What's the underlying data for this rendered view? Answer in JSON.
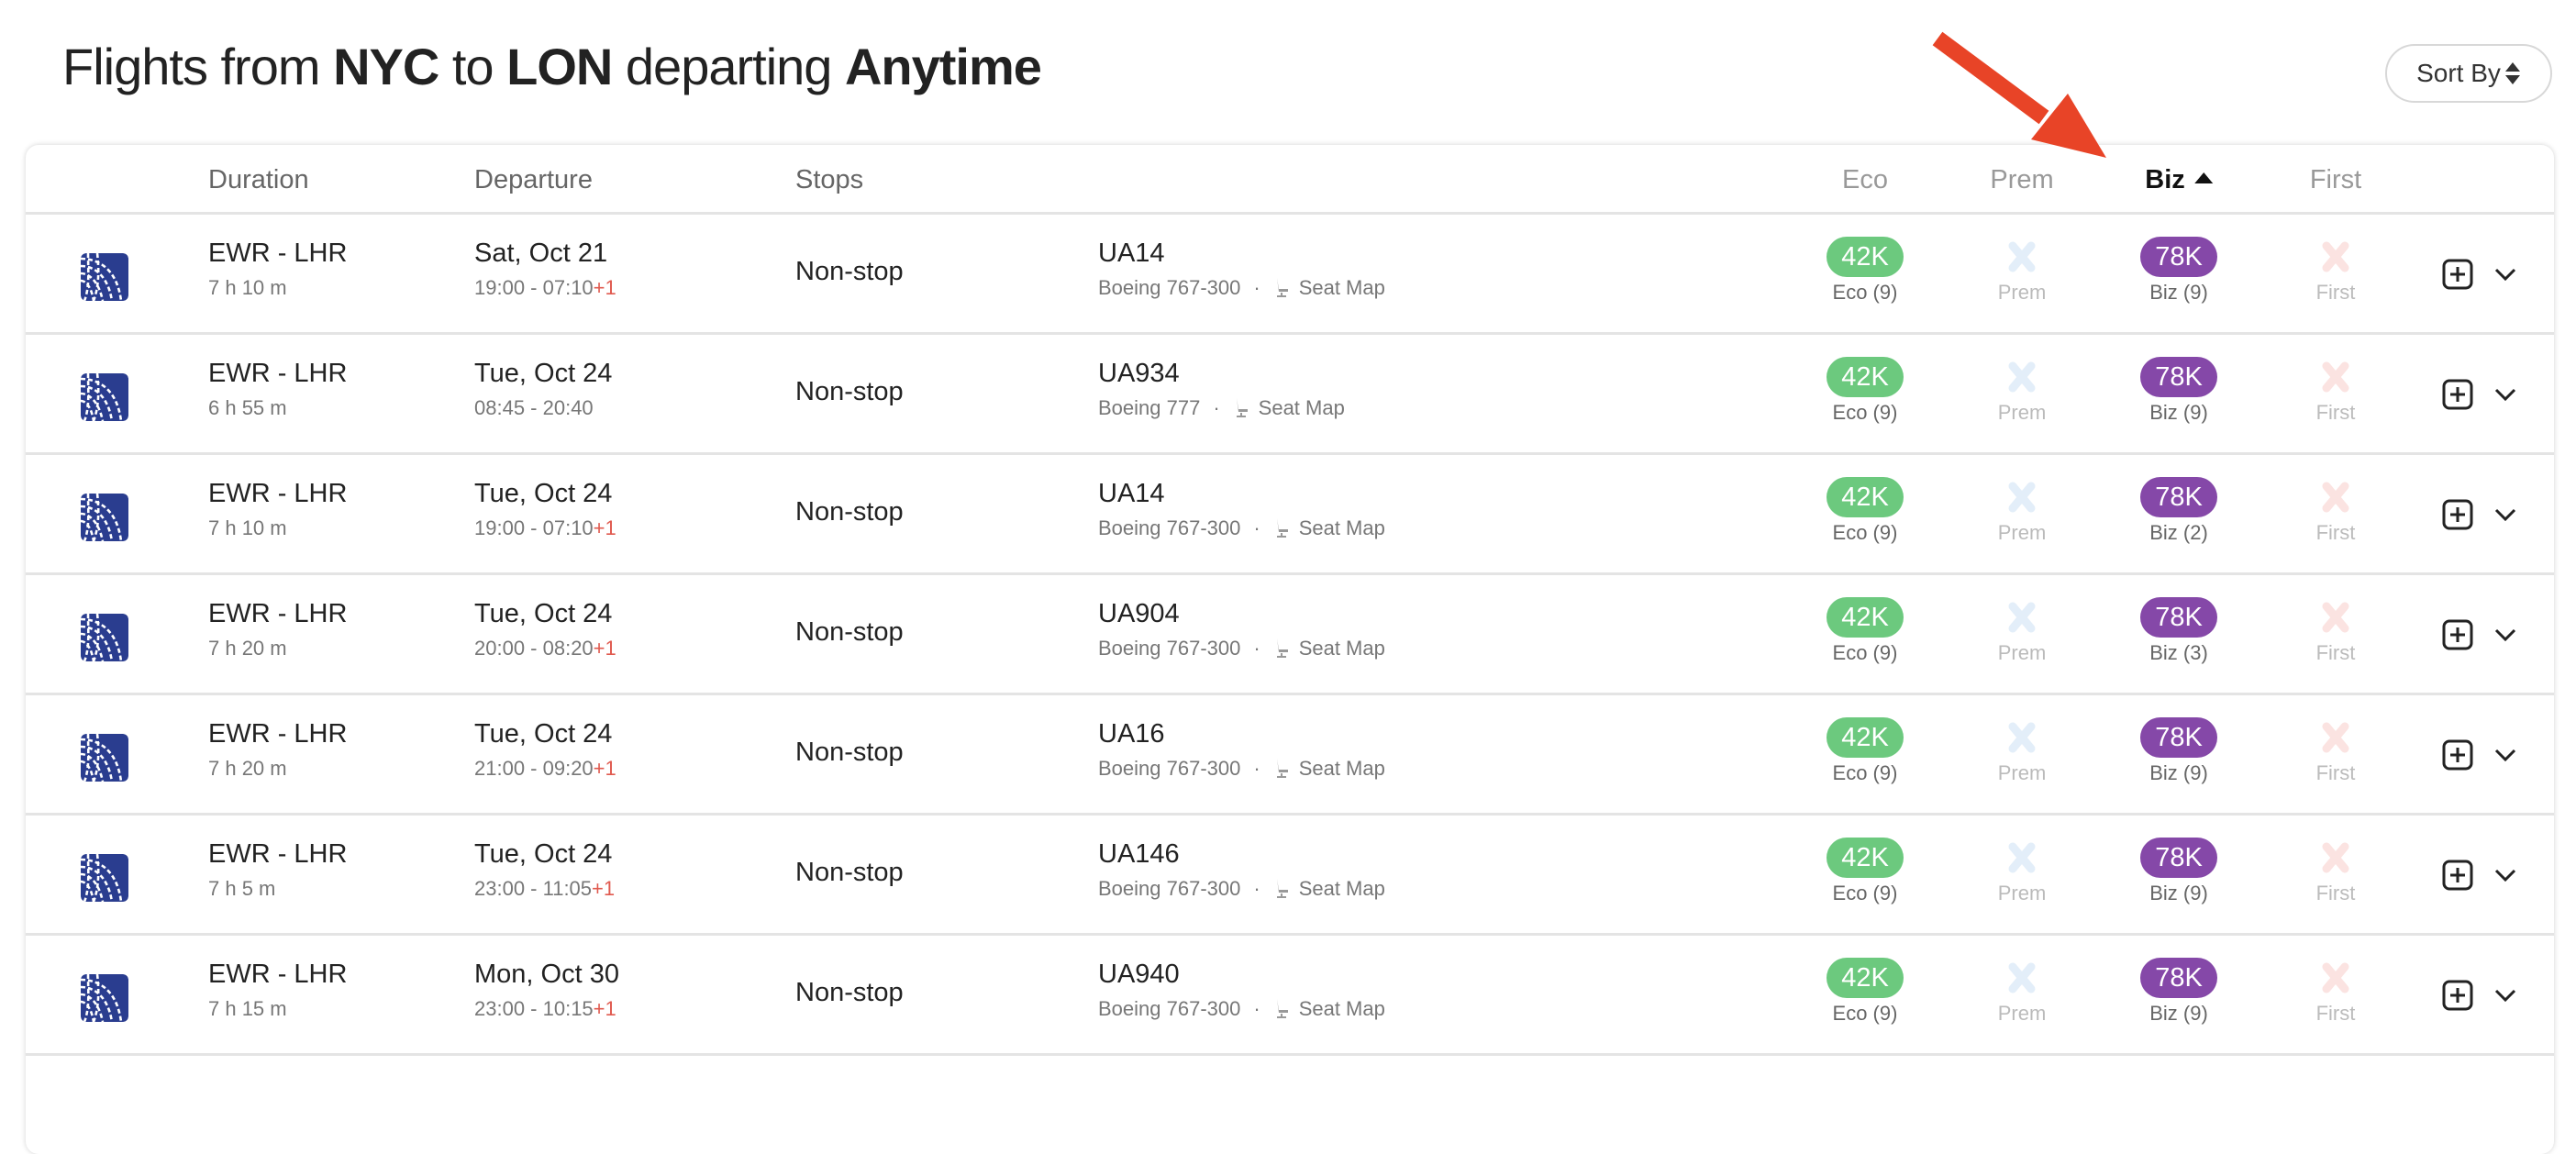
{
  "title": {
    "prefix": "Flights from",
    "origin": "NYC",
    "to": "to",
    "destination": "LON",
    "departing": "departing",
    "when": "Anytime"
  },
  "sort_button": {
    "label": "Sort By",
    "icon": "sort-updown-icon"
  },
  "header": {
    "duration": "Duration",
    "departure": "Departure",
    "stops": "Stops",
    "eco": "Eco",
    "prem": "Prem",
    "biz": "Biz",
    "first": "First",
    "sorted_column": "biz",
    "sort_direction": "ascending"
  },
  "colors": {
    "eco_pill": "#6cc97e",
    "biz_pill": "#8548a8",
    "prem_unavailable": "#e3eef9",
    "first_unavailable": "#fbe3e1",
    "next_day": "#e05a4f",
    "annotation_arrow": "#e84427",
    "airline_logo": "#2a3d8f"
  },
  "annotation": {
    "type": "arrow",
    "points_to": "Biz column header"
  },
  "flights": [
    {
      "airline": "United",
      "route": "EWR - LHR",
      "duration": "7 h 10 m",
      "date": "Sat, Oct 21",
      "times": "19:00 - 07:10",
      "next_day": "+1",
      "stops": "Non-stop",
      "flight": "UA14",
      "aircraft": "Boeing 767-300",
      "seat_map": "Seat Map",
      "eco_price": "42K",
      "eco_label": "Eco (9)",
      "prem_label": "Prem",
      "biz_price": "78K",
      "biz_label": "Biz (9)",
      "first_label": "First"
    },
    {
      "airline": "United",
      "route": "EWR - LHR",
      "duration": "6 h 55 m",
      "date": "Tue, Oct 24",
      "times": "08:45 - 20:40",
      "next_day": "",
      "stops": "Non-stop",
      "flight": "UA934",
      "aircraft": "Boeing 777",
      "seat_map": "Seat Map",
      "eco_price": "42K",
      "eco_label": "Eco (9)",
      "prem_label": "Prem",
      "biz_price": "78K",
      "biz_label": "Biz (9)",
      "first_label": "First"
    },
    {
      "airline": "United",
      "route": "EWR - LHR",
      "duration": "7 h 10 m",
      "date": "Tue, Oct 24",
      "times": "19:00 - 07:10",
      "next_day": "+1",
      "stops": "Non-stop",
      "flight": "UA14",
      "aircraft": "Boeing 767-300",
      "seat_map": "Seat Map",
      "eco_price": "42K",
      "eco_label": "Eco (9)",
      "prem_label": "Prem",
      "biz_price": "78K",
      "biz_label": "Biz (2)",
      "first_label": "First"
    },
    {
      "airline": "United",
      "route": "EWR - LHR",
      "duration": "7 h 20 m",
      "date": "Tue, Oct 24",
      "times": "20:00 - 08:20",
      "next_day": "+1",
      "stops": "Non-stop",
      "flight": "UA904",
      "aircraft": "Boeing 767-300",
      "seat_map": "Seat Map",
      "eco_price": "42K",
      "eco_label": "Eco (9)",
      "prem_label": "Prem",
      "biz_price": "78K",
      "biz_label": "Biz (3)",
      "first_label": "First"
    },
    {
      "airline": "United",
      "route": "EWR - LHR",
      "duration": "7 h 20 m",
      "date": "Tue, Oct 24",
      "times": "21:00 - 09:20",
      "next_day": "+1",
      "stops": "Non-stop",
      "flight": "UA16",
      "aircraft": "Boeing 767-300",
      "seat_map": "Seat Map",
      "eco_price": "42K",
      "eco_label": "Eco (9)",
      "prem_label": "Prem",
      "biz_price": "78K",
      "biz_label": "Biz (9)",
      "first_label": "First"
    },
    {
      "airline": "United",
      "route": "EWR - LHR",
      "duration": "7 h 5 m",
      "date": "Tue, Oct 24",
      "times": "23:00 - 11:05",
      "next_day": "+1",
      "stops": "Non-stop",
      "flight": "UA146",
      "aircraft": "Boeing 767-300",
      "seat_map": "Seat Map",
      "eco_price": "42K",
      "eco_label": "Eco (9)",
      "prem_label": "Prem",
      "biz_price": "78K",
      "biz_label": "Biz (9)",
      "first_label": "First"
    },
    {
      "airline": "United",
      "route": "EWR - LHR",
      "duration": "7 h 15 m",
      "date": "Mon, Oct 30",
      "times": "23:00 - 10:15",
      "next_day": "+1",
      "stops": "Non-stop",
      "flight": "UA940",
      "aircraft": "Boeing 767-300",
      "seat_map": "Seat Map",
      "eco_price": "42K",
      "eco_label": "Eco (9)",
      "prem_label": "Prem",
      "biz_price": "78K",
      "biz_label": "Biz (9)",
      "first_label": "First"
    }
  ]
}
